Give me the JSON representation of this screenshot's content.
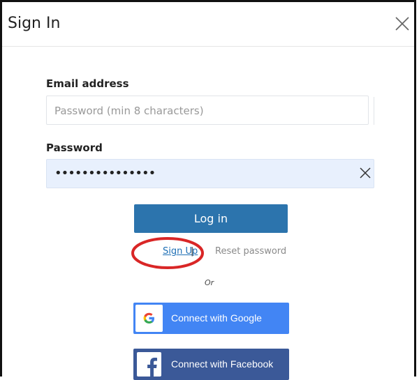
{
  "dialog": {
    "title": "Sign In",
    "close_label": "×"
  },
  "form": {
    "email_label": "Email address",
    "email_placeholder": "Password (min 8 characters)",
    "password_label": "Password",
    "password_value": "•••••••••••••••"
  },
  "buttons": {
    "login": "Log in",
    "signup": "Sign Up",
    "separator": "|",
    "reset": "Reset password",
    "or": "Or",
    "google": "Connect with Google",
    "facebook": "Connect with Facebook"
  },
  "colors": {
    "primary": "#2c74ad",
    "google": "#4285f4",
    "facebook": "#3b5998",
    "highlight": "#d92626"
  }
}
